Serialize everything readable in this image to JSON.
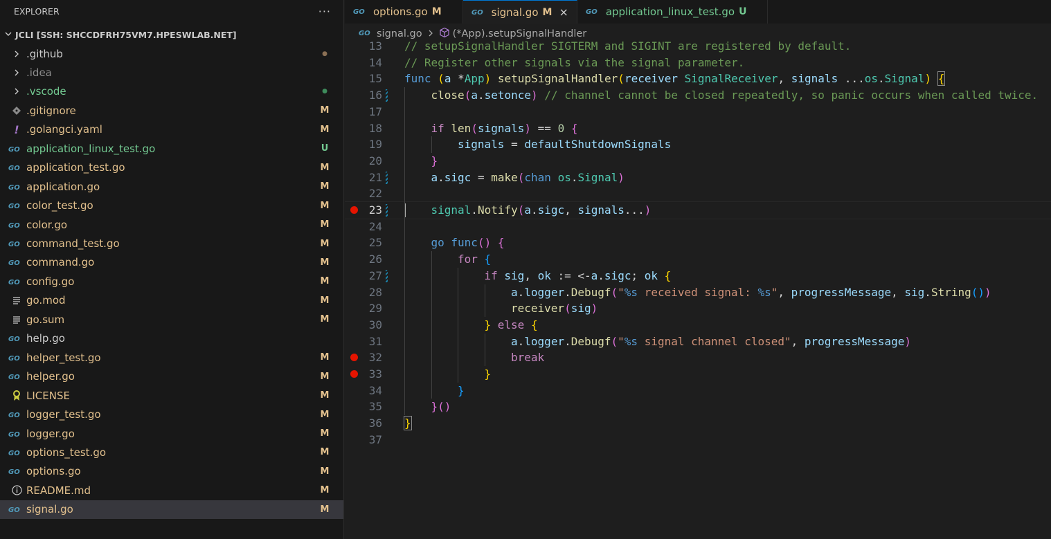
{
  "colors": {
    "modified": "#e2c08d",
    "untracked": "#73c991",
    "ignored": "#8c8c8c",
    "go_icon": "#519aba",
    "readme_icon": "#519aba",
    "license_icon": "#cbcb41",
    "yaml_icon": "#a074c4",
    "breakpoint": "#e51400"
  },
  "sidebar": {
    "header": "EXPLORER",
    "more_icon": "ellipsis-icon",
    "root": "JCLI [SSH: SHCCDFRH75VM7.HPESWLAB.NET]",
    "files": [
      {
        "name": ".github",
        "icon": "chevron-right-icon",
        "status": "●",
        "kind": "folder-dot-modified"
      },
      {
        "name": ".idea",
        "icon": "chevron-right-icon",
        "status": "",
        "kind": "folder-ignored"
      },
      {
        "name": ".vscode",
        "icon": "chevron-right-icon",
        "status": "●",
        "kind": "folder-dot-untracked"
      },
      {
        "name": ".gitignore",
        "icon": "git-icon",
        "status": "M",
        "kind": "modified"
      },
      {
        "name": ".golangci.yaml",
        "icon": "yaml-icon",
        "status": "M",
        "kind": "modified"
      },
      {
        "name": "application_linux_test.go",
        "icon": "go-icon",
        "status": "U",
        "kind": "untracked"
      },
      {
        "name": "application_test.go",
        "icon": "go-icon",
        "status": "M",
        "kind": "modified"
      },
      {
        "name": "application.go",
        "icon": "go-icon",
        "status": "M",
        "kind": "modified"
      },
      {
        "name": "color_test.go",
        "icon": "go-icon",
        "status": "M",
        "kind": "modified"
      },
      {
        "name": "color.go",
        "icon": "go-icon",
        "status": "M",
        "kind": "modified"
      },
      {
        "name": "command_test.go",
        "icon": "go-icon",
        "status": "M",
        "kind": "modified"
      },
      {
        "name": "command.go",
        "icon": "go-icon",
        "status": "M",
        "kind": "modified"
      },
      {
        "name": "config.go",
        "icon": "go-icon",
        "status": "M",
        "kind": "modified"
      },
      {
        "name": "go.mod",
        "icon": "list-icon",
        "status": "M",
        "kind": "modified"
      },
      {
        "name": "go.sum",
        "icon": "list-icon",
        "status": "M",
        "kind": "modified"
      },
      {
        "name": "help.go",
        "icon": "go-icon",
        "status": "",
        "kind": "plain"
      },
      {
        "name": "helper_test.go",
        "icon": "go-icon",
        "status": "M",
        "kind": "modified"
      },
      {
        "name": "helper.go",
        "icon": "go-icon",
        "status": "M",
        "kind": "modified"
      },
      {
        "name": "LICENSE",
        "icon": "license-icon",
        "status": "M",
        "kind": "modified"
      },
      {
        "name": "logger_test.go",
        "icon": "go-icon",
        "status": "M",
        "kind": "modified"
      },
      {
        "name": "logger.go",
        "icon": "go-icon",
        "status": "M",
        "kind": "modified"
      },
      {
        "name": "options_test.go",
        "icon": "go-icon",
        "status": "M",
        "kind": "modified"
      },
      {
        "name": "options.go",
        "icon": "go-icon",
        "status": "M",
        "kind": "modified"
      },
      {
        "name": "README.md",
        "icon": "info-icon",
        "status": "M",
        "kind": "modified"
      },
      {
        "name": "signal.go",
        "icon": "go-icon",
        "status": "M",
        "kind": "modified-active"
      }
    ]
  },
  "tabs": [
    {
      "label": "options.go",
      "status": "M",
      "active": false,
      "kind": "modified"
    },
    {
      "label": "signal.go",
      "status": "M",
      "active": true,
      "kind": "modified",
      "close": "×"
    },
    {
      "label": "application_linux_test.go",
      "status": "U",
      "active": false,
      "kind": "untracked"
    }
  ],
  "breadcrumb": {
    "file": "signal.go",
    "symbol": "(*App).setupSignalHandler"
  },
  "editor": {
    "current_line": 23,
    "lines": [
      {
        "n": 13,
        "indent": 0,
        "tokens": [
          [
            "// setupSignalHandler SIGTERM and SIGINT are registered by default.",
            "com"
          ]
        ]
      },
      {
        "n": 14,
        "indent": 0,
        "tokens": [
          [
            "// Register other signals via the signal parameter.",
            "com"
          ]
        ]
      },
      {
        "n": 15,
        "indent": 0,
        "tokens": [
          [
            "func",
            "kw"
          ],
          [
            " ",
            "def"
          ],
          [
            "(",
            "p1"
          ],
          [
            "a",
            "var"
          ],
          [
            " *",
            "def"
          ],
          [
            "App",
            "ty"
          ],
          [
            ")",
            "p1"
          ],
          [
            " ",
            "def"
          ],
          [
            "setupSignalHandler",
            "fn"
          ],
          [
            "(",
            "p1"
          ],
          [
            "receiver",
            "var"
          ],
          [
            " ",
            "def"
          ],
          [
            "SignalReceiver",
            "ty"
          ],
          [
            ", ",
            "def"
          ],
          [
            "signals",
            "var"
          ],
          [
            " ...",
            "def"
          ],
          [
            "os",
            "ty"
          ],
          [
            ".",
            "def"
          ],
          [
            "Signal",
            "ty"
          ],
          [
            ")",
            "p1"
          ],
          [
            " ",
            "def"
          ],
          [
            "{",
            "p1m"
          ]
        ]
      },
      {
        "n": 16,
        "indent": 1,
        "git": true,
        "tokens": [
          [
            "close",
            "fn"
          ],
          [
            "(",
            "p2"
          ],
          [
            "a",
            "var"
          ],
          [
            ".",
            "def"
          ],
          [
            "setonce",
            "var"
          ],
          [
            ")",
            "p2"
          ],
          [
            " // channel cannot be closed repeatedly, so panic occurs when called twice.",
            "com"
          ]
        ]
      },
      {
        "n": 17,
        "indent": 0,
        "tokens": []
      },
      {
        "n": 18,
        "indent": 1,
        "tokens": [
          [
            "if",
            "ctl"
          ],
          [
            " ",
            "def"
          ],
          [
            "len",
            "fn"
          ],
          [
            "(",
            "p2"
          ],
          [
            "signals",
            "var"
          ],
          [
            ")",
            "p2"
          ],
          [
            " == ",
            "def"
          ],
          [
            "0",
            "num"
          ],
          [
            " ",
            "def"
          ],
          [
            "{",
            "p2"
          ]
        ]
      },
      {
        "n": 19,
        "indent": 2,
        "tokens": [
          [
            "signals",
            "var"
          ],
          [
            " = ",
            "def"
          ],
          [
            "defaultShutdownSignals",
            "var"
          ]
        ]
      },
      {
        "n": 20,
        "indent": 1,
        "tokens": [
          [
            "}",
            "p2"
          ]
        ]
      },
      {
        "n": 21,
        "indent": 1,
        "git": true,
        "tokens": [
          [
            "a",
            "var"
          ],
          [
            ".",
            "def"
          ],
          [
            "sigc",
            "var"
          ],
          [
            " = ",
            "def"
          ],
          [
            "make",
            "fn"
          ],
          [
            "(",
            "p2"
          ],
          [
            "chan",
            "kw"
          ],
          [
            " ",
            "def"
          ],
          [
            "os",
            "ty"
          ],
          [
            ".",
            "def"
          ],
          [
            "Signal",
            "ty"
          ],
          [
            ")",
            "p2"
          ]
        ]
      },
      {
        "n": 22,
        "indent": 0,
        "tokens": []
      },
      {
        "n": 23,
        "indent": 1,
        "bp": true,
        "git": true,
        "tokens": [
          [
            "signal",
            "ty"
          ],
          [
            ".",
            "def"
          ],
          [
            "Notify",
            "fn"
          ],
          [
            "(",
            "p2"
          ],
          [
            "a",
            "var"
          ],
          [
            ".",
            "def"
          ],
          [
            "sigc",
            "var"
          ],
          [
            ", ",
            "def"
          ],
          [
            "signals",
            "var"
          ],
          [
            "...",
            "def"
          ],
          [
            ")",
            "p2"
          ]
        ]
      },
      {
        "n": 24,
        "indent": 0,
        "tokens": []
      },
      {
        "n": 25,
        "indent": 1,
        "tokens": [
          [
            "go",
            "kw"
          ],
          [
            " ",
            "def"
          ],
          [
            "func",
            "kw"
          ],
          [
            "()",
            "p2"
          ],
          [
            " ",
            "def"
          ],
          [
            "{",
            "p2"
          ]
        ]
      },
      {
        "n": 26,
        "indent": 2,
        "tokens": [
          [
            "for",
            "ctl"
          ],
          [
            " ",
            "def"
          ],
          [
            "{",
            "p3"
          ]
        ]
      },
      {
        "n": 27,
        "indent": 3,
        "git": true,
        "tokens": [
          [
            "if",
            "ctl"
          ],
          [
            " ",
            "def"
          ],
          [
            "sig",
            "var"
          ],
          [
            ", ",
            "def"
          ],
          [
            "ok",
            "var"
          ],
          [
            " := <-",
            "def"
          ],
          [
            "a",
            "var"
          ],
          [
            ".",
            "def"
          ],
          [
            "sigc",
            "var"
          ],
          [
            "; ",
            "def"
          ],
          [
            "ok",
            "var"
          ],
          [
            " ",
            "def"
          ],
          [
            "{",
            "p1"
          ]
        ]
      },
      {
        "n": 28,
        "indent": 4,
        "tokens": [
          [
            "a",
            "var"
          ],
          [
            ".",
            "def"
          ],
          [
            "logger",
            "var"
          ],
          [
            ".",
            "def"
          ],
          [
            "Debugf",
            "fn"
          ],
          [
            "(",
            "p2"
          ],
          [
            "\"",
            "str"
          ],
          [
            "%s",
            "kw"
          ],
          [
            " received signal: ",
            "str"
          ],
          [
            "%s",
            "kw"
          ],
          [
            "\"",
            "str"
          ],
          [
            ", ",
            "def"
          ],
          [
            "progressMessage",
            "var"
          ],
          [
            ", ",
            "def"
          ],
          [
            "sig",
            "var"
          ],
          [
            ".",
            "def"
          ],
          [
            "String",
            "fn"
          ],
          [
            "()",
            "p3"
          ],
          [
            ")",
            "p2"
          ]
        ]
      },
      {
        "n": 29,
        "indent": 4,
        "tokens": [
          [
            "receiver",
            "fn"
          ],
          [
            "(",
            "p2"
          ],
          [
            "sig",
            "var"
          ],
          [
            ")",
            "p2"
          ]
        ]
      },
      {
        "n": 30,
        "indent": 3,
        "tokens": [
          [
            "}",
            "p1"
          ],
          [
            " ",
            "def"
          ],
          [
            "else",
            "ctl"
          ],
          [
            " ",
            "def"
          ],
          [
            "{",
            "p1"
          ]
        ]
      },
      {
        "n": 31,
        "indent": 4,
        "tokens": [
          [
            "a",
            "var"
          ],
          [
            ".",
            "def"
          ],
          [
            "logger",
            "var"
          ],
          [
            ".",
            "def"
          ],
          [
            "Debugf",
            "fn"
          ],
          [
            "(",
            "p2"
          ],
          [
            "\"",
            "str"
          ],
          [
            "%s",
            "kw"
          ],
          [
            " signal channel closed\"",
            "str"
          ],
          [
            ", ",
            "def"
          ],
          [
            "progressMessage",
            "var"
          ],
          [
            ")",
            "p2"
          ]
        ]
      },
      {
        "n": 32,
        "indent": 4,
        "bp": true,
        "tokens": [
          [
            "break",
            "ctl"
          ]
        ]
      },
      {
        "n": 33,
        "indent": 3,
        "bp": true,
        "tokens": [
          [
            "}",
            "p1"
          ]
        ]
      },
      {
        "n": 34,
        "indent": 2,
        "tokens": [
          [
            "}",
            "p3"
          ]
        ]
      },
      {
        "n": 35,
        "indent": 1,
        "tokens": [
          [
            "}",
            "p2"
          ],
          [
            "()",
            "p2"
          ]
        ]
      },
      {
        "n": 36,
        "indent": 0,
        "tokens": [
          [
            "}",
            "p1m"
          ]
        ]
      },
      {
        "n": 37,
        "indent": 0,
        "tokens": []
      }
    ]
  }
}
